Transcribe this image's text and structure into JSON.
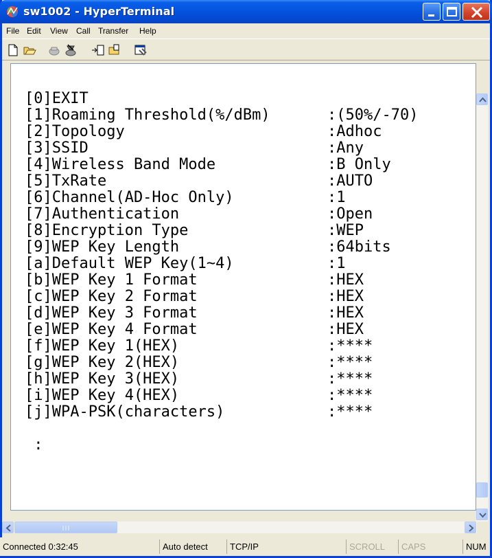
{
  "window": {
    "title": "sw1002 - HyperTerminal",
    "app_icon": "hyperterminal-icon",
    "controls": [
      "minimize",
      "maximize",
      "close"
    ]
  },
  "menubar": {
    "items": [
      "File",
      "Edit",
      "View",
      "Call",
      "Transfer",
      "Help"
    ]
  },
  "toolbar": {
    "icons": [
      "new-icon",
      "open-icon",
      "connect-icon",
      "disconnect-icon",
      "send-icon",
      "receive-icon",
      "properties-icon"
    ]
  },
  "terminal": {
    "lines": [
      {
        "label": "[0]EXIT",
        "value": ""
      },
      {
        "label": "[1]Roaming Threshold(%/dBm)",
        "value": ":(50%/-70)"
      },
      {
        "label": "[2]Topology",
        "value": ":Adhoc"
      },
      {
        "label": "[3]SSID",
        "value": ":Any"
      },
      {
        "label": "[4]Wireless Band Mode",
        "value": ":B Only"
      },
      {
        "label": "[5]TxRate",
        "value": ":AUTO"
      },
      {
        "label": "[6]Channel(AD-Hoc Only)",
        "value": ":1"
      },
      {
        "label": "[7]Authentication",
        "value": ":Open"
      },
      {
        "label": "[8]Encryption Type",
        "value": ":WEP"
      },
      {
        "label": "[9]WEP Key Length",
        "value": ":64bits"
      },
      {
        "label": "[a]Default WEP Key(1~4)",
        "value": ":1"
      },
      {
        "label": "[b]WEP Key 1 Format",
        "value": ":HEX"
      },
      {
        "label": "[c]WEP Key 2 Format",
        "value": ":HEX"
      },
      {
        "label": "[d]WEP Key 3 Format",
        "value": ":HEX"
      },
      {
        "label": "[e]WEP Key 4 Format",
        "value": ":HEX"
      },
      {
        "label": "[f]WEP Key 1(HEX)",
        "value": ":****"
      },
      {
        "label": "[g]WEP Key 2(HEX)",
        "value": ":****"
      },
      {
        "label": "[h]WEP Key 3(HEX)",
        "value": ":****"
      },
      {
        "label": "[i]WEP Key 4(HEX)",
        "value": ":****"
      },
      {
        "label": "[j]WPA-PSK(characters)",
        "value": ":****"
      },
      {
        "label": "",
        "value": ""
      },
      {
        "label": " :",
        "value": ""
      }
    ]
  },
  "statusbar": {
    "connected": "Connected 0:32:45",
    "detect": "Auto detect",
    "protocol": "TCP/IP",
    "scroll": "SCROLL",
    "caps": "CAPS",
    "num": "NUM"
  }
}
